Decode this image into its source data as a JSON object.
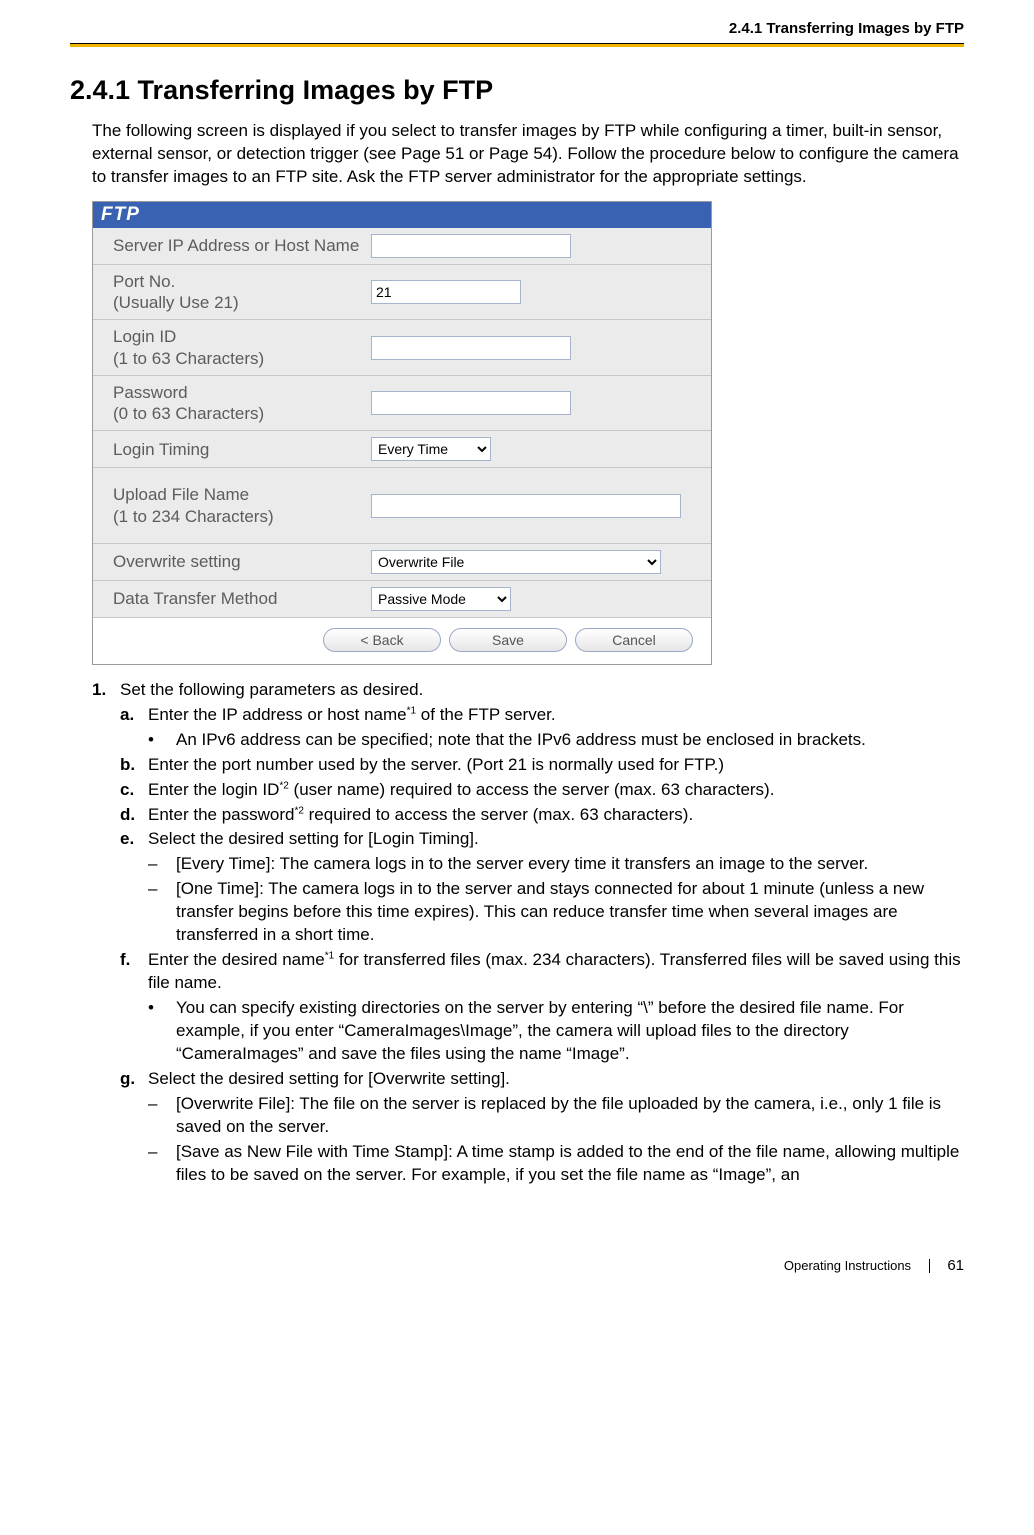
{
  "header": {
    "running": "2.4.1 Transferring Images by FTP"
  },
  "title": "2.4.1  Transferring Images by FTP",
  "intro": "The following screen is displayed if you select to transfer images by FTP while configuring a timer, built-in sensor, external sensor, or detection trigger (see Page 51 or Page 54). Follow the procedure below to configure the camera to transfer images to an FTP site. Ask the FTP server administrator for the appropriate settings.",
  "ftp": {
    "panel_title": "FTP",
    "rows": {
      "server": {
        "label": "Server IP Address or Host Name",
        "value": ""
      },
      "port": {
        "label": "Port No.\n(Usually Use 21)",
        "value": "21"
      },
      "login": {
        "label": "Login ID\n(1 to 63 Characters)",
        "value": ""
      },
      "password": {
        "label": "Password\n(0 to 63 Characters)",
        "value": ""
      },
      "timing": {
        "label": "Login Timing",
        "value": "Every Time"
      },
      "filename": {
        "label": "Upload File Name\n(1 to 234 Characters)",
        "value": ""
      },
      "overwrite": {
        "label": "Overwrite setting",
        "value": "Overwrite File"
      },
      "method": {
        "label": "Data Transfer Method",
        "value": "Passive Mode"
      }
    },
    "buttons": {
      "back": "< Back",
      "save": "Save",
      "cancel": "Cancel"
    }
  },
  "list": {
    "step1": "Set the following parameters as desired.",
    "a": {
      "pre": "Enter the IP address or host name",
      "sup": "*1",
      "post": " of the FTP server."
    },
    "a_bullet": "An IPv6 address can be specified; note that the IPv6 address must be enclosed in brackets.",
    "b": "Enter the port number used by the server. (Port 21 is normally used for FTP.)",
    "c": {
      "pre": "Enter the login ID",
      "sup": "*2",
      "post": " (user name) required to access the server (max. 63 characters)."
    },
    "d": {
      "pre": "Enter the password",
      "sup": "*2",
      "post": " required to access the server (max. 63 characters)."
    },
    "e": "Select the desired setting for [Login Timing].",
    "e_dash1": "[Every Time]: The camera logs in to the server every time it transfers an image to the server.",
    "e_dash2": "[One Time]: The camera logs in to the server and stays connected for about 1 minute (unless a new transfer begins before this time expires). This can reduce transfer time when several images are transferred in a short time.",
    "f": {
      "pre": "Enter the desired name",
      "sup": "*1",
      "post": " for transferred files (max. 234 characters). Transferred files will be saved using this file name."
    },
    "f_bullet": "You can specify existing directories on the server by entering “\\” before the desired file name. For example, if you enter “CameraImages\\Image”, the camera will upload files to the directory “CameraImages” and save the files using the name “Image”.",
    "g": "Select the desired setting for [Overwrite setting].",
    "g_dash1": "[Overwrite File]: The file on the server is replaced by the file uploaded by the camera, i.e., only 1 file is saved on the server.",
    "g_dash2": "[Save as New File with Time Stamp]: A time stamp is added to the end of the file name, allowing multiple files to be saved on the server. For example, if you set the file name as “Image”, an"
  },
  "footer": {
    "doc": "Operating Instructions",
    "page": "61"
  }
}
